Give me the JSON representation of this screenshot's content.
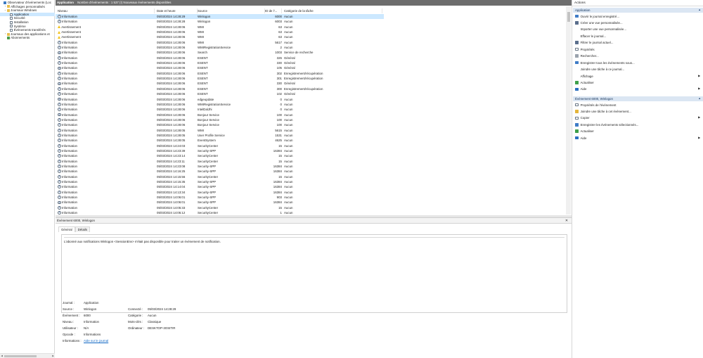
{
  "tree": {
    "items": [
      {
        "label": "Observateur d'événements (Loc",
        "indent": 0,
        "twisty": "",
        "icon": "root",
        "selected": false
      },
      {
        "label": "Affichages personnalisés",
        "indent": 1,
        "twisty": "›",
        "icon": "folder",
        "selected": false
      },
      {
        "label": "Journaux Windows",
        "indent": 1,
        "twisty": "⌄",
        "icon": "folder",
        "selected": false
      },
      {
        "label": "Application",
        "indent": 2,
        "twisty": "",
        "icon": "log",
        "selected": true
      },
      {
        "label": "Sécurité",
        "indent": 2,
        "twisty": "",
        "icon": "log",
        "selected": false
      },
      {
        "label": "Installation",
        "indent": 2,
        "twisty": "",
        "icon": "log",
        "selected": false
      },
      {
        "label": "Système",
        "indent": 2,
        "twisty": "",
        "icon": "log",
        "selected": false
      },
      {
        "label": "Événements transférés",
        "indent": 2,
        "twisty": "",
        "icon": "log",
        "selected": false
      },
      {
        "label": "Journaux des applications et",
        "indent": 1,
        "twisty": "›",
        "icon": "folder",
        "selected": false
      },
      {
        "label": "Abonnements",
        "indent": 1,
        "twisty": "",
        "icon": "filter",
        "selected": false
      }
    ]
  },
  "topbar": {
    "log_name": "Application",
    "count_text": "Nombre d'événements : 1 537 (!) Nouveaux événements disponibles"
  },
  "grid": {
    "headers": [
      "Niveau",
      "Date et heure",
      "Source",
      "ID de l'...",
      "Catégorie de la tâche"
    ],
    "rows": [
      {
        "level": "info",
        "level_label": "Information",
        "date": "05/03/2024 14:28:29",
        "source": "Winlogon",
        "id": "6000",
        "task": "Aucun",
        "selected": true
      },
      {
        "level": "info",
        "level_label": "Information",
        "date": "05/03/2024 14:28:28",
        "source": "Winlogon",
        "id": "6003",
        "task": "Aucun",
        "selected": false
      },
      {
        "level": "warn",
        "level_label": "Avertissement",
        "date": "05/03/2024 14:28:06",
        "source": "WMI",
        "id": "63",
        "task": "Aucun",
        "selected": false
      },
      {
        "level": "warn",
        "level_label": "Avertissement",
        "date": "05/03/2024 14:28:06",
        "source": "WMI",
        "id": "63",
        "task": "Aucun",
        "selected": false
      },
      {
        "level": "warn",
        "level_label": "Avertissement",
        "date": "05/03/2024 14:28:06",
        "source": "WMI",
        "id": "63",
        "task": "Aucun",
        "selected": false
      },
      {
        "level": "info",
        "level_label": "Information",
        "date": "05/03/2024 14:28:06",
        "source": "WMI",
        "id": "5617",
        "task": "Aucun",
        "selected": false
      },
      {
        "level": "info",
        "level_label": "Information",
        "date": "05/03/2024 14:28:06",
        "source": "WMIRegistrationService",
        "id": "2",
        "task": "Aucun",
        "selected": false
      },
      {
        "level": "info",
        "level_label": "Information",
        "date": "05/03/2024 14:28:06",
        "source": "Search",
        "id": "1003",
        "task": "Service de recherche",
        "selected": false
      },
      {
        "level": "info",
        "level_label": "Information",
        "date": "05/03/2024 14:28:06",
        "source": "ESENT",
        "id": "326",
        "task": "Général",
        "selected": false
      },
      {
        "level": "info",
        "level_label": "Information",
        "date": "05/03/2024 14:28:06",
        "source": "ESENT",
        "id": "330",
        "task": "Général",
        "selected": false
      },
      {
        "level": "info",
        "level_label": "Information",
        "date": "05/03/2024 14:28:06",
        "source": "ESENT",
        "id": "105",
        "task": "Général",
        "selected": false
      },
      {
        "level": "info",
        "level_label": "Information",
        "date": "05/03/2024 14:28:06",
        "source": "ESENT",
        "id": "302",
        "task": "Enregistrement/récupération",
        "selected": false
      },
      {
        "level": "info",
        "level_label": "Information",
        "date": "05/03/2024 14:28:06",
        "source": "ESENT",
        "id": "301",
        "task": "Enregistrement/récupération",
        "selected": false
      },
      {
        "level": "info",
        "level_label": "Information",
        "date": "05/03/2024 14:28:06",
        "source": "ESENT",
        "id": "330",
        "task": "Général",
        "selected": false
      },
      {
        "level": "info",
        "level_label": "Information",
        "date": "05/03/2024 14:28:06",
        "source": "ESENT",
        "id": "300",
        "task": "Enregistrement/récupération",
        "selected": false
      },
      {
        "level": "info",
        "level_label": "Information",
        "date": "05/03/2024 14:28:06",
        "source": "ESENT",
        "id": "102",
        "task": "Général",
        "selected": false
      },
      {
        "level": "info",
        "level_label": "Information",
        "date": "05/03/2024 14:28:06",
        "source": "edgeupdate",
        "id": "0",
        "task": "Aucun",
        "selected": false
      },
      {
        "level": "info",
        "level_label": "Information",
        "date": "05/03/2024 14:28:06",
        "source": "WMIRegistrationService",
        "id": "0",
        "task": "Aucun",
        "selected": false
      },
      {
        "level": "info",
        "level_label": "Information",
        "date": "05/03/2024 14:28:06",
        "source": "IntelDalJhi",
        "id": "0",
        "task": "Aucun",
        "selected": false
      },
      {
        "level": "info",
        "level_label": "Information",
        "date": "05/03/2024 14:28:06",
        "source": "Bonjour Service",
        "id": "100",
        "task": "Aucun",
        "selected": false
      },
      {
        "level": "info",
        "level_label": "Information",
        "date": "05/03/2024 14:28:06",
        "source": "Bonjour Service",
        "id": "100",
        "task": "Aucun",
        "selected": false
      },
      {
        "level": "info",
        "level_label": "Information",
        "date": "05/03/2024 14:28:06",
        "source": "Bonjour Service",
        "id": "100",
        "task": "Aucun",
        "selected": false
      },
      {
        "level": "info",
        "level_label": "Information",
        "date": "05/03/2024 14:28:05",
        "source": "WMI",
        "id": "5615",
        "task": "Aucun",
        "selected": false
      },
      {
        "level": "info",
        "level_label": "Information",
        "date": "05/03/2024 14:28:05",
        "source": "User Profile Service",
        "id": "1531",
        "task": "Aucun",
        "selected": false
      },
      {
        "level": "info",
        "level_label": "Information",
        "date": "05/03/2024 14:28:05",
        "source": "EventSystem",
        "id": "4625",
        "task": "Aucun",
        "selected": false
      },
      {
        "level": "info",
        "level_label": "Information",
        "date": "05/03/2024 14:24:03",
        "source": "SecurityCenter",
        "id": "15",
        "task": "Aucun",
        "selected": false
      },
      {
        "level": "info",
        "level_label": "Information",
        "date": "05/03/2024 14:23:39",
        "source": "Security-SPP",
        "id": "16384",
        "task": "Aucun",
        "selected": false
      },
      {
        "level": "info",
        "level_label": "Information",
        "date": "05/03/2024 14:23:14",
        "source": "SecurityCenter",
        "id": "15",
        "task": "Aucun",
        "selected": false
      },
      {
        "level": "info",
        "level_label": "Information",
        "date": "05/03/2024 14:23:11",
        "source": "SecurityCenter",
        "id": "15",
        "task": "Aucun",
        "selected": false
      },
      {
        "level": "info",
        "level_label": "Information",
        "date": "05/03/2024 14:23:08",
        "source": "Security-SPP",
        "id": "16384",
        "task": "Aucun",
        "selected": false
      },
      {
        "level": "info",
        "level_label": "Information",
        "date": "05/03/2024 14:16:25",
        "source": "Security-SPP",
        "id": "16384",
        "task": "Aucun",
        "selected": false
      },
      {
        "level": "info",
        "level_label": "Information",
        "date": "05/03/2024 14:15:56",
        "source": "SecurityCenter",
        "id": "15",
        "task": "Aucun",
        "selected": false
      },
      {
        "level": "info",
        "level_label": "Information",
        "date": "05/03/2024 14:15:35",
        "source": "Security-SPP",
        "id": "16384",
        "task": "Aucun",
        "selected": false
      },
      {
        "level": "info",
        "level_label": "Information",
        "date": "05/03/2024 14:14:04",
        "source": "Security-SPP",
        "id": "16384",
        "task": "Aucun",
        "selected": false
      },
      {
        "level": "info",
        "level_label": "Information",
        "date": "05/03/2024 14:13:34",
        "source": "Security-SPP",
        "id": "16384",
        "task": "Aucun",
        "selected": false
      },
      {
        "level": "info",
        "level_label": "Information",
        "date": "05/03/2024 14:06:01",
        "source": "Security-SPP",
        "id": "903",
        "task": "Aucun",
        "selected": false
      },
      {
        "level": "info",
        "level_label": "Information",
        "date": "05/03/2024 14:06:01",
        "source": "Security-SPP",
        "id": "16384",
        "task": "Aucun",
        "selected": false
      },
      {
        "level": "info",
        "level_label": "Information",
        "date": "05/03/2024 14:05:33",
        "source": "SecurityCenter",
        "id": "15",
        "task": "Aucun",
        "selected": false
      },
      {
        "level": "info",
        "level_label": "Information",
        "date": "05/03/2024 14:05:12",
        "source": "SecurityCenter",
        "id": "1",
        "task": "Aucun",
        "selected": false
      }
    ]
  },
  "detail": {
    "title": "Événement 6000, Winlogon",
    "close": "✕",
    "tabs": [
      "Général",
      "Détails"
    ],
    "message": "L'abonné aux notifications Winlogon <SessionEnv> n'était pas disponible pour traiter un événement de notification.",
    "labels": {
      "journal": "Journal :",
      "source": "Source :",
      "evenement": "Événement :",
      "niveau": "Niveau :",
      "utilisateur": "Utilisateur :",
      "opcode": "Opcode :",
      "informations": "Informations :",
      "connecte": "Connecté :",
      "categorie": "Catégorie :",
      "motscles": "Mots-clés :",
      "ordinateur": "Ordinateur :"
    },
    "values": {
      "journal": "Application",
      "source": "Winlogon",
      "evenement": "6000",
      "niveau": "Information",
      "utilisateur": "N/A",
      "opcode": "Informations",
      "informations": "Aide sur le journal",
      "connecte": "05/03/2024 14:28:29",
      "categorie": "Aucun",
      "motscles": "Classique",
      "ordinateur": "DESKTOP-3OSITIR"
    }
  },
  "actions": {
    "title": "Actions",
    "section1": "Application",
    "section1_items": [
      {
        "label": "Ouvrir le journal enregistré...",
        "icon": "blue",
        "arrow": ""
      },
      {
        "label": "Créer une vue personnalisée...",
        "icon": "funnel",
        "arrow": ""
      },
      {
        "label": "Importer une vue personnalisée...",
        "icon": "none",
        "arrow": ""
      },
      {
        "label": "Effacer le journal...",
        "icon": "none",
        "arrow": ""
      },
      {
        "label": "Filtrer le journal actuel...",
        "icon": "funnel",
        "arrow": ""
      },
      {
        "label": "Propriétés",
        "icon": "doc",
        "arrow": ""
      },
      {
        "label": "Rechercher...",
        "icon": "gray",
        "arrow": ""
      },
      {
        "label": "Enregistrer tous les événements sous...",
        "icon": "blue",
        "arrow": ""
      },
      {
        "label": "Joindre une tâche à ce journal...",
        "icon": "none",
        "arrow": ""
      },
      {
        "label": "Affichage",
        "icon": "none",
        "arrow": "▶"
      },
      {
        "label": "Actualiser",
        "icon": "green",
        "arrow": ""
      },
      {
        "label": "Aide",
        "icon": "help",
        "arrow": "▶"
      }
    ],
    "section2": "Événement 6000, Winlogon",
    "section2_items": [
      {
        "label": "Propriétés de l'événement",
        "icon": "doc",
        "arrow": ""
      },
      {
        "label": "Joindre une tâche à cet événement...",
        "icon": "yellow",
        "arrow": ""
      },
      {
        "label": "Copier",
        "icon": "doc",
        "arrow": "▶"
      },
      {
        "label": "Enregistrer les événements sélectionnés...",
        "icon": "blue",
        "arrow": ""
      },
      {
        "label": "Actualiser",
        "icon": "green",
        "arrow": ""
      },
      {
        "label": "Aide",
        "icon": "help",
        "arrow": "▶"
      }
    ],
    "collapse_glyph": "▲"
  }
}
